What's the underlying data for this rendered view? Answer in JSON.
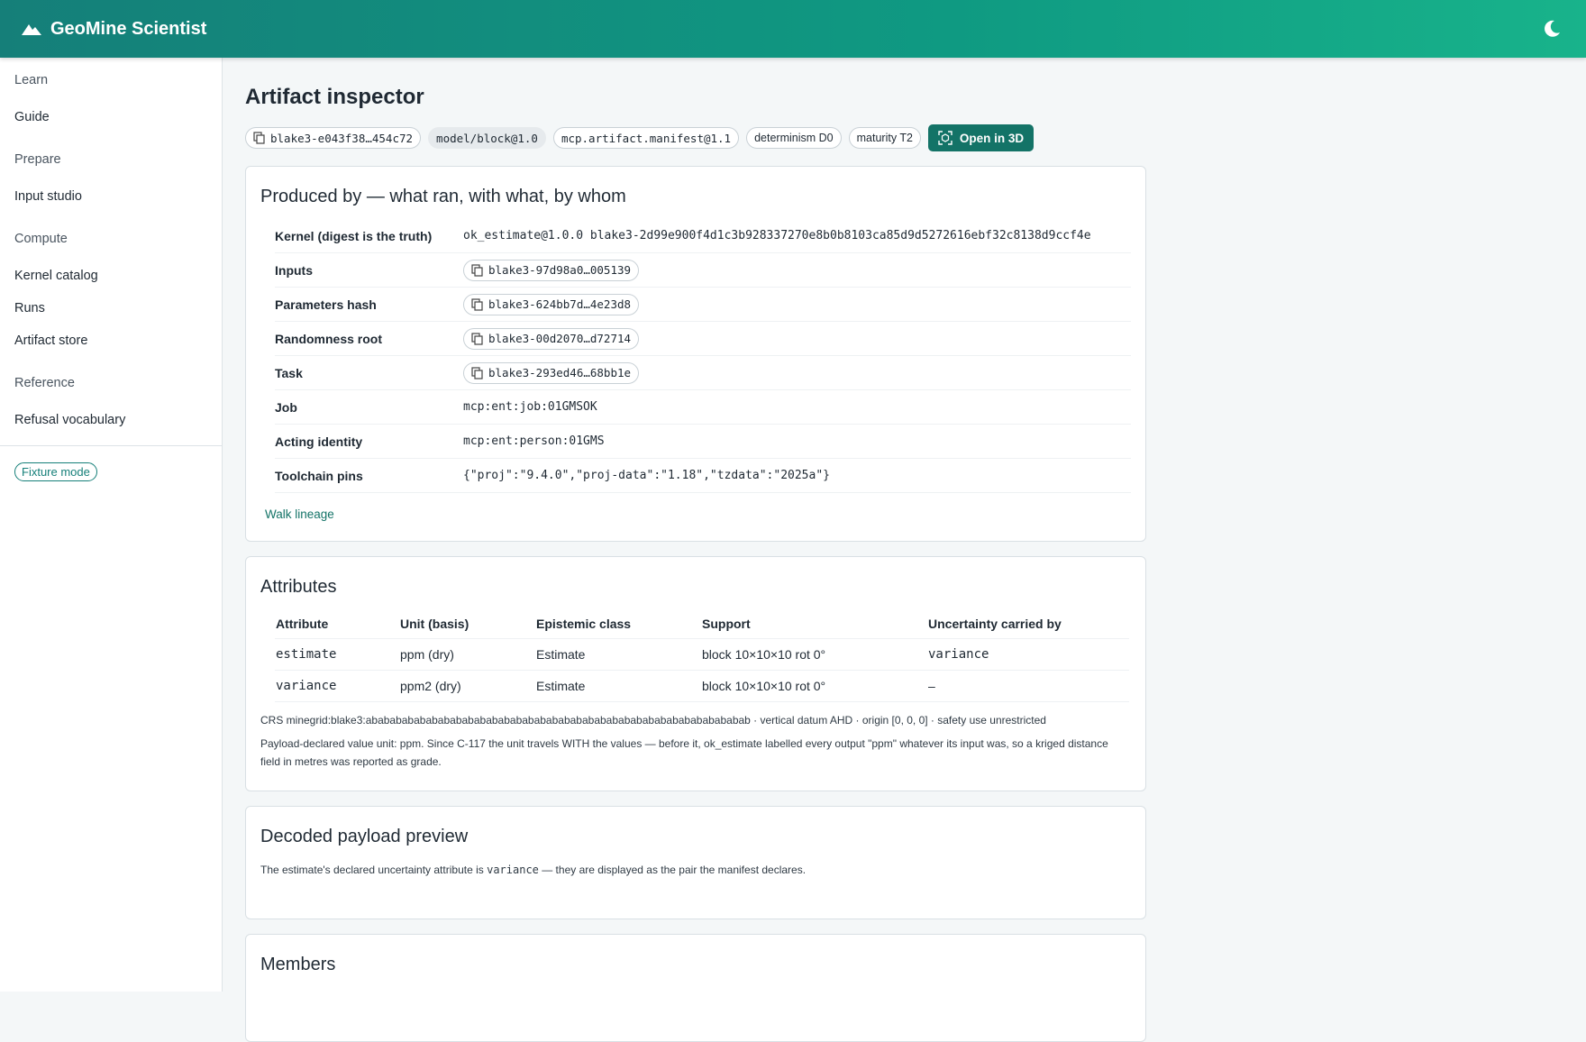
{
  "header": {
    "brand": "GeoMine Scientist",
    "icons": {
      "brand": "mountain-icon",
      "theme": "moon-icon"
    },
    "accent": "#137367"
  },
  "sidebar": {
    "sections": [
      {
        "heading": "Learn",
        "items": [
          "Guide"
        ]
      },
      {
        "heading": "Prepare",
        "items": [
          "Input studio"
        ]
      },
      {
        "heading": "Compute",
        "items": [
          "Kernel catalog",
          "Runs",
          "Artifact store"
        ]
      },
      {
        "heading": "Reference",
        "items": [
          "Refusal vocabulary"
        ]
      }
    ],
    "fixture_mode": "Fixture mode"
  },
  "page": {
    "title": "Artifact inspector",
    "chips": {
      "digest": "blake3-e043f38…454c72",
      "schema": "model/block@1.0",
      "manifest": "mcp.artifact.manifest@1.1",
      "determinism": "determinism D0",
      "maturity": "maturity T2"
    },
    "open_3d": "Open in 3D"
  },
  "produced_by": {
    "title": "Produced by — what ran, with what, by whom",
    "rows": {
      "kernel": {
        "label": "Kernel (digest is the truth)",
        "value": "ok_estimate@1.0.0 blake3-2d99e900f4d1c3b928337270e8b0b8103ca85d9d5272616ebf32c8138d9ccf4e"
      },
      "inputs": {
        "label": "Inputs",
        "value": "blake3-97d98a0…005139"
      },
      "params": {
        "label": "Parameters hash",
        "value": "blake3-624bb7d…4e23d8"
      },
      "random": {
        "label": "Randomness root",
        "value": "blake3-00d2070…d72714"
      },
      "task": {
        "label": "Task",
        "value": "blake3-293ed46…68bb1e"
      },
      "job": {
        "label": "Job",
        "value": "mcp:ent:job:01GMSOK"
      },
      "identity": {
        "label": "Acting identity",
        "value": "mcp:ent:person:01GMS"
      },
      "toolchain": {
        "label": "Toolchain pins",
        "value": "{\"proj\":\"9.4.0\",\"proj-data\":\"1.18\",\"tzdata\":\"2025a\"}"
      }
    },
    "walk_lineage": "Walk lineage"
  },
  "attributes": {
    "title": "Attributes",
    "columns": [
      "Attribute",
      "Unit (basis)",
      "Epistemic class",
      "Support",
      "Uncertainty carried by"
    ],
    "rows": [
      [
        "estimate",
        "ppm (dry)",
        "Estimate",
        "block 10×10×10 rot 0°",
        "variance"
      ],
      [
        "variance",
        "ppm2 (dry)",
        "Estimate",
        "block 10×10×10 rot 0°",
        "–"
      ]
    ],
    "crs_note": "CRS minegrid:blake3:abababababababababababababababababababababababababababababababab · vertical datum AHD · origin [0, 0, 0] · safety use unrestricted",
    "unit_note": "Payload-declared value unit: ppm. Since C-117 the unit travels WITH the values — before it, ok_estimate labelled every output \"ppm\" whatever its input was, so a kriged distance field in metres was reported as grade."
  },
  "payload": {
    "title": "Decoded payload preview",
    "note_prefix": "The estimate's declared uncertainty attribute is ",
    "note_code": "variance",
    "note_suffix": " — they are displayed as the pair the manifest declares."
  },
  "members": {
    "title": "Members"
  }
}
